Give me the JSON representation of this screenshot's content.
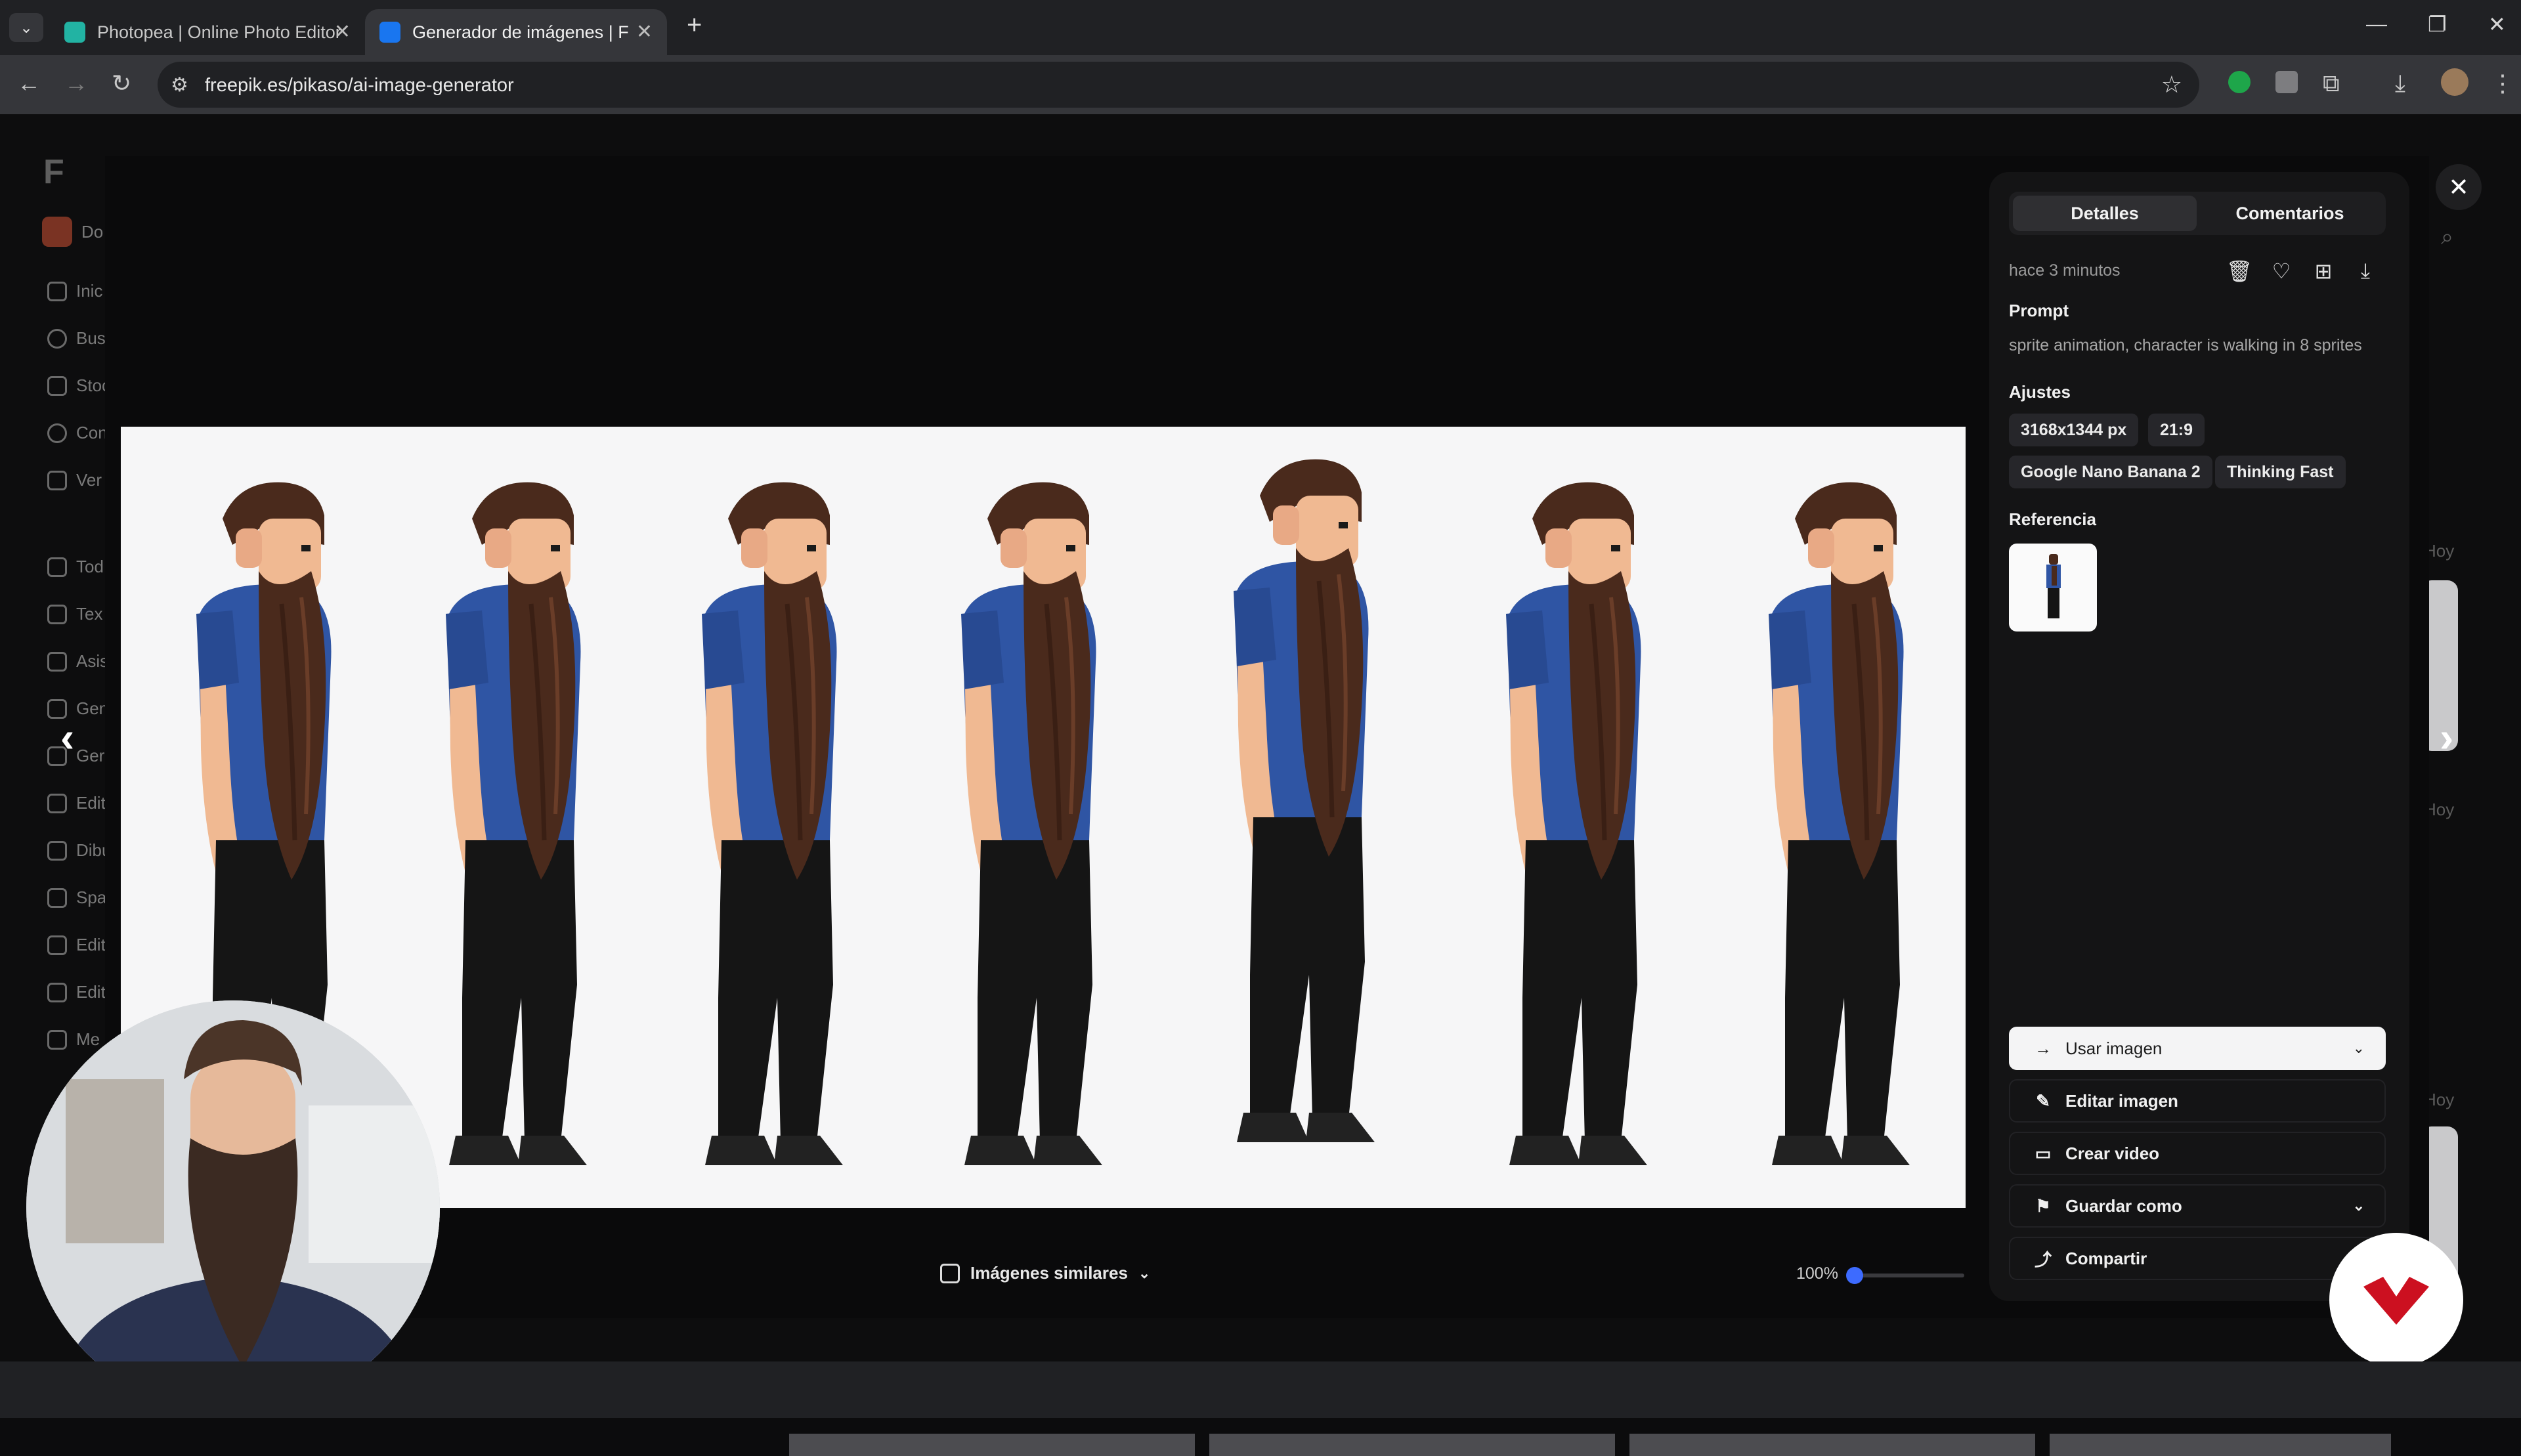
{
  "browser": {
    "tabs": [
      {
        "title": "Photopea | Online Photo Editor",
        "active": false
      },
      {
        "title": "Generador de imágenes | Freep",
        "active": true
      }
    ],
    "new_tab": "+",
    "url": "freepik.es/pikaso/ai-image-generator"
  },
  "sidebar": {
    "logo": "F",
    "workspace": "Do",
    "items": [
      "Inic",
      "Bus",
      "Stoc",
      "Con",
      "Ver",
      "Tod",
      "Tex",
      "Asis",
      "Gen",
      "Ger",
      "Edit",
      "Dibu",
      "Spa",
      "Edit",
      "Edit",
      "Me"
    ]
  },
  "viewer": {
    "similar_images_label": "Imágenes similares",
    "zoom_label": "100%",
    "zoom_fraction": 0.0
  },
  "panel": {
    "tabs": [
      "Detalles",
      "Comentarios"
    ],
    "timestamp": "hace 3 minutos",
    "prompt_label": "Prompt",
    "prompt_text": "sprite animation, character is walking in 8 sprites",
    "settings_label": "Ajustes",
    "chips": [
      "3168x1344 px",
      "21:9",
      "Google Nano Banana 2",
      "Thinking Fast"
    ],
    "reference_label": "Referencia",
    "use_image": "Usar imagen",
    "actions": [
      "Editar imagen",
      "Crear video",
      "Guardar como",
      "Compartir"
    ]
  },
  "background": {
    "date_labels": [
      "Hoy",
      "Hoy",
      "Hoy"
    ]
  },
  "colors": {
    "shirt": "#2f55a4",
    "beard": "#4a2a1c",
    "skin": "#f0b992",
    "pants": "#151515",
    "brand_red": "#cc1020"
  }
}
